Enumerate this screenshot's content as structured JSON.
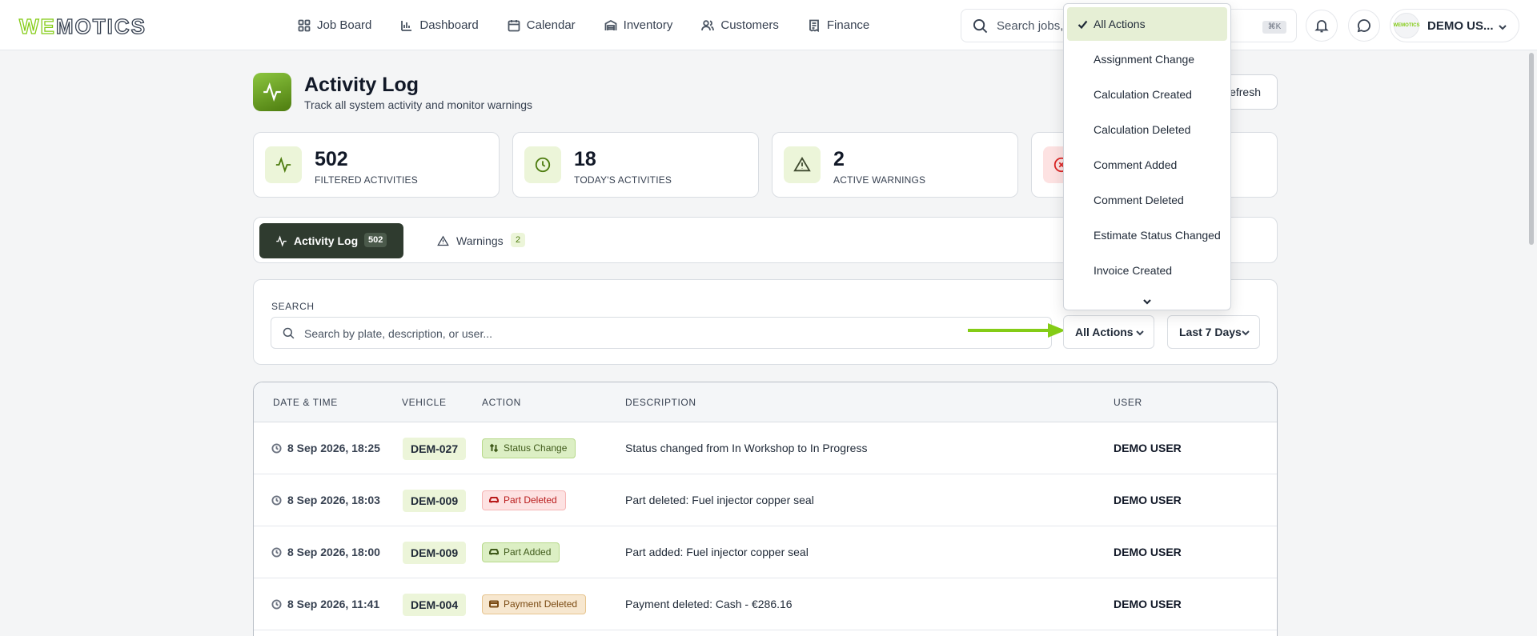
{
  "app": {
    "logo_prefix": "WE",
    "logo_suffix": "MOTICS"
  },
  "nav": [
    {
      "label": "Job Board",
      "icon": "grid-icon"
    },
    {
      "label": "Dashboard",
      "icon": "bar-chart-icon"
    },
    {
      "label": "Calendar",
      "icon": "calendar-icon"
    },
    {
      "label": "Inventory",
      "icon": "warehouse-icon"
    },
    {
      "label": "Customers",
      "icon": "users-icon"
    },
    {
      "label": "Finance",
      "icon": "receipt-icon"
    }
  ],
  "header": {
    "search_placeholder": "Search jobs, c",
    "shortcut": "⌘K",
    "user_name": "DEMO US...",
    "avatar_text": "WEMOTICS"
  },
  "page": {
    "title": "Activity Log",
    "subtitle": "Track all system activity and monitor warnings",
    "refresh_label": "efresh"
  },
  "stats": [
    {
      "value": "502",
      "label": "FILTERED ACTIVITIES",
      "icon": "activity-icon"
    },
    {
      "value": "18",
      "label": "TODAY'S ACTIVITIES",
      "icon": "clock-icon"
    },
    {
      "value": "2",
      "label": "ACTIVE WARNINGS",
      "icon": "warning-icon"
    },
    {
      "value": "",
      "label": "",
      "icon": "x-circle-icon"
    }
  ],
  "tabs": [
    {
      "label": "Activity Log",
      "count": "502",
      "active": true
    },
    {
      "label": "Warnings",
      "count": "2",
      "active": false
    }
  ],
  "filters": {
    "search_label": "SEARCH",
    "search_placeholder": "Search by plate, description, or user...",
    "action_value": "All Actions",
    "range_value": "Last 7 Days"
  },
  "table": {
    "columns": [
      "DATE & TIME",
      "VEHICLE",
      "ACTION",
      "DESCRIPTION",
      "USER"
    ],
    "rows": [
      {
        "date": "8 Sep 2026, 18:25",
        "vehicle": "DEM-027",
        "action": "Status Change",
        "action_icon": "arrows-updown-icon",
        "description": "Status changed from In Workshop to In Progress",
        "user": "DEMO USER"
      },
      {
        "date": "8 Sep 2026, 18:03",
        "vehicle": "DEM-009",
        "action": "Part Deleted",
        "action_icon": "car-icon",
        "description": "Part deleted: Fuel injector copper seal",
        "user": "DEMO USER"
      },
      {
        "date": "8 Sep 2026, 18:00",
        "vehicle": "DEM-009",
        "action": "Part Added",
        "action_icon": "car-icon",
        "description": "Part added: Fuel injector copper seal",
        "user": "DEMO USER"
      },
      {
        "date": "8 Sep 2026, 11:41",
        "vehicle": "DEM-004",
        "action": "Payment Deleted",
        "action_icon": "card-icon",
        "description": "Payment deleted: Cash - €286.16",
        "user": "DEMO USER"
      }
    ]
  },
  "dropdown": {
    "options": [
      "All Actions",
      "Assignment Change",
      "Calculation Created",
      "Calculation Deleted",
      "Comment Added",
      "Comment Deleted",
      "Estimate Status Changed",
      "Invoice Created"
    ],
    "selected_index": 0
  },
  "colors": {
    "accent": "#84cc16",
    "active_tab": "#2f3b2f",
    "status_badge": "#dcefc4",
    "deleted_badge": "#fde2e2",
    "payment_badge": "#f7e7cf"
  }
}
